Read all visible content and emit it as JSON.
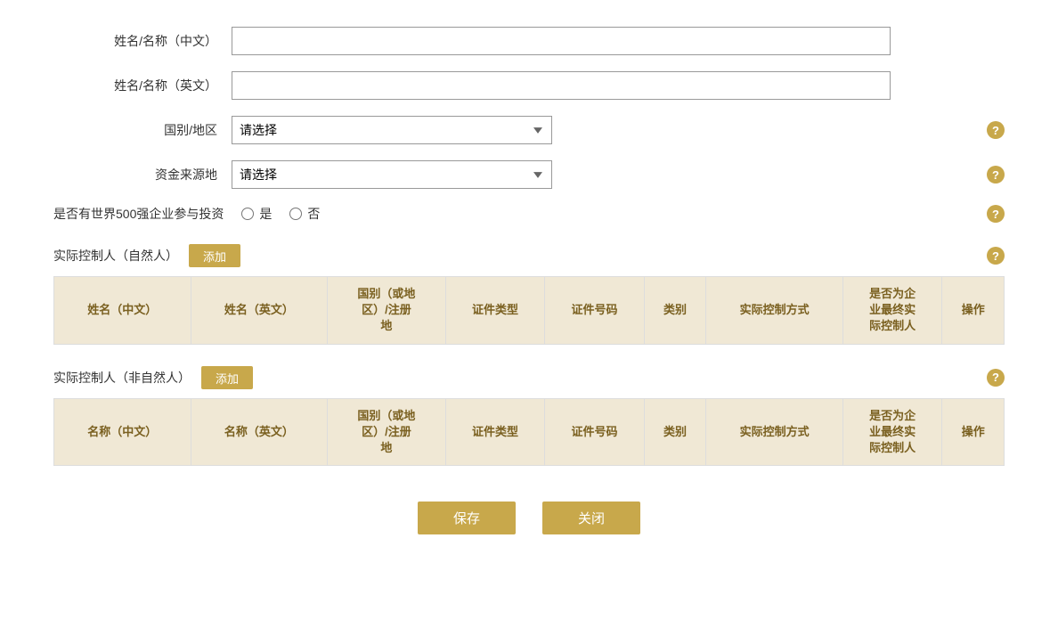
{
  "form": {
    "name_cn_label": "姓名/名称（中文）",
    "name_en_label": "姓名/名称（英文）",
    "country_label": "国别/地区",
    "country_placeholder": "请选择",
    "fund_source_label": "资金来源地",
    "fund_source_placeholder": "请选择",
    "fortune500_label": "是否有世界500强企业参与投资",
    "radio_yes": "是",
    "radio_no": "否",
    "help_icon_text": "?"
  },
  "section1": {
    "title": "实际控制人（自然人）",
    "add_label": "添加",
    "columns": [
      "姓名（中文）",
      "姓名（英文）",
      "国别（或地\n区）/注册\n地",
      "证件类型",
      "证件号码",
      "类别",
      "实际控制方式",
      "是否为企\n业最终实\n际控制人",
      "操作"
    ]
  },
  "section2": {
    "title": "实际控制人（非自然人）",
    "add_label": "添加",
    "columns": [
      "名称（中文）",
      "名称（英文）",
      "国别（或地\n区）/注册\n地",
      "证件类型",
      "证件号码",
      "类别",
      "实际控制方式",
      "是否为企\n业最终实\n际控制人",
      "操作"
    ]
  },
  "buttons": {
    "save": "保存",
    "close": "关闭"
  }
}
